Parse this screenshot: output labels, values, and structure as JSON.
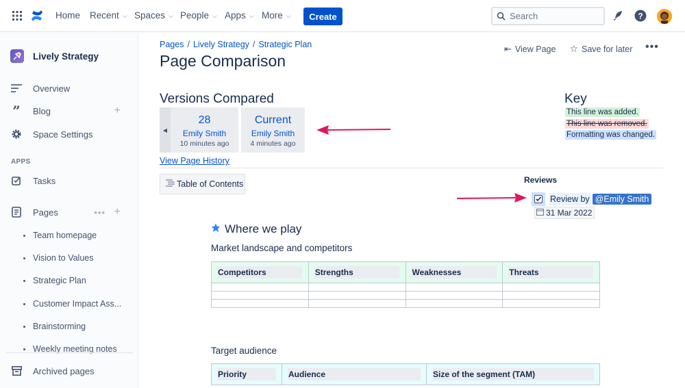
{
  "nav": {
    "items": [
      {
        "label": "Home",
        "has_menu": false
      },
      {
        "label": "Recent",
        "has_menu": true
      },
      {
        "label": "Spaces",
        "has_menu": true
      },
      {
        "label": "People",
        "has_menu": true
      },
      {
        "label": "Apps",
        "has_menu": true
      },
      {
        "label": "More",
        "has_menu": true
      }
    ],
    "create_label": "Create",
    "search_placeholder": "Search"
  },
  "sidebar": {
    "space_name": "Lively Strategy",
    "items": [
      {
        "label": "Overview",
        "icon": "overview-icon"
      },
      {
        "label": "Blog",
        "icon": "quote-icon"
      },
      {
        "label": "Space Settings",
        "icon": "gear-icon"
      }
    ],
    "apps_section": "APPS",
    "apps": [
      {
        "label": "Tasks",
        "icon": "tasks-icon"
      }
    ],
    "pages_label": "Pages",
    "pages": [
      "Team homepage",
      "Vision to Values",
      "Strategic Plan",
      "Customer Impact Ass...",
      "Brainstorming",
      "Weekly meeting notes"
    ],
    "archived_label": "Archived pages"
  },
  "breadcrumb": [
    "Pages",
    "Lively Strategy",
    "Strategic Plan"
  ],
  "page_title": "Page Comparison",
  "header_actions": {
    "view_page": "View Page",
    "save_later": "Save for later"
  },
  "versions": {
    "title": "Versions Compared",
    "left": {
      "number": "28",
      "author": "Emily Smith",
      "time": "10 minutes ago"
    },
    "right": {
      "number": "Current",
      "author": "Emily Smith",
      "time": "4 minutes ago"
    },
    "history_link": "View Page History"
  },
  "key": {
    "title": "Key",
    "added": "This line was added.",
    "removed": "This line was removed.",
    "changed": "Formatting was changed."
  },
  "toc_label": "Table of Contents",
  "reviews": {
    "title": "Reviews",
    "review_text": "Review by",
    "mention": "@Emily Smith",
    "date": "31 Mar 2022"
  },
  "content": {
    "heading": "Where we play",
    "market_text": "Market landscape and competitors",
    "competitor_headers": [
      "Competitors",
      "Strengths",
      "Weaknesses",
      "Threats"
    ],
    "audience_text": "Target audience",
    "audience_headers": [
      "Priority",
      "Audience",
      "Size of the segment (TAM)"
    ]
  },
  "colors": {
    "brand": "#0052cc",
    "arrow": "#e2175b",
    "added_bg": "#d3f1d9",
    "removed_bg": "#ffd9d6",
    "changed_bg": "#cce0ff"
  }
}
